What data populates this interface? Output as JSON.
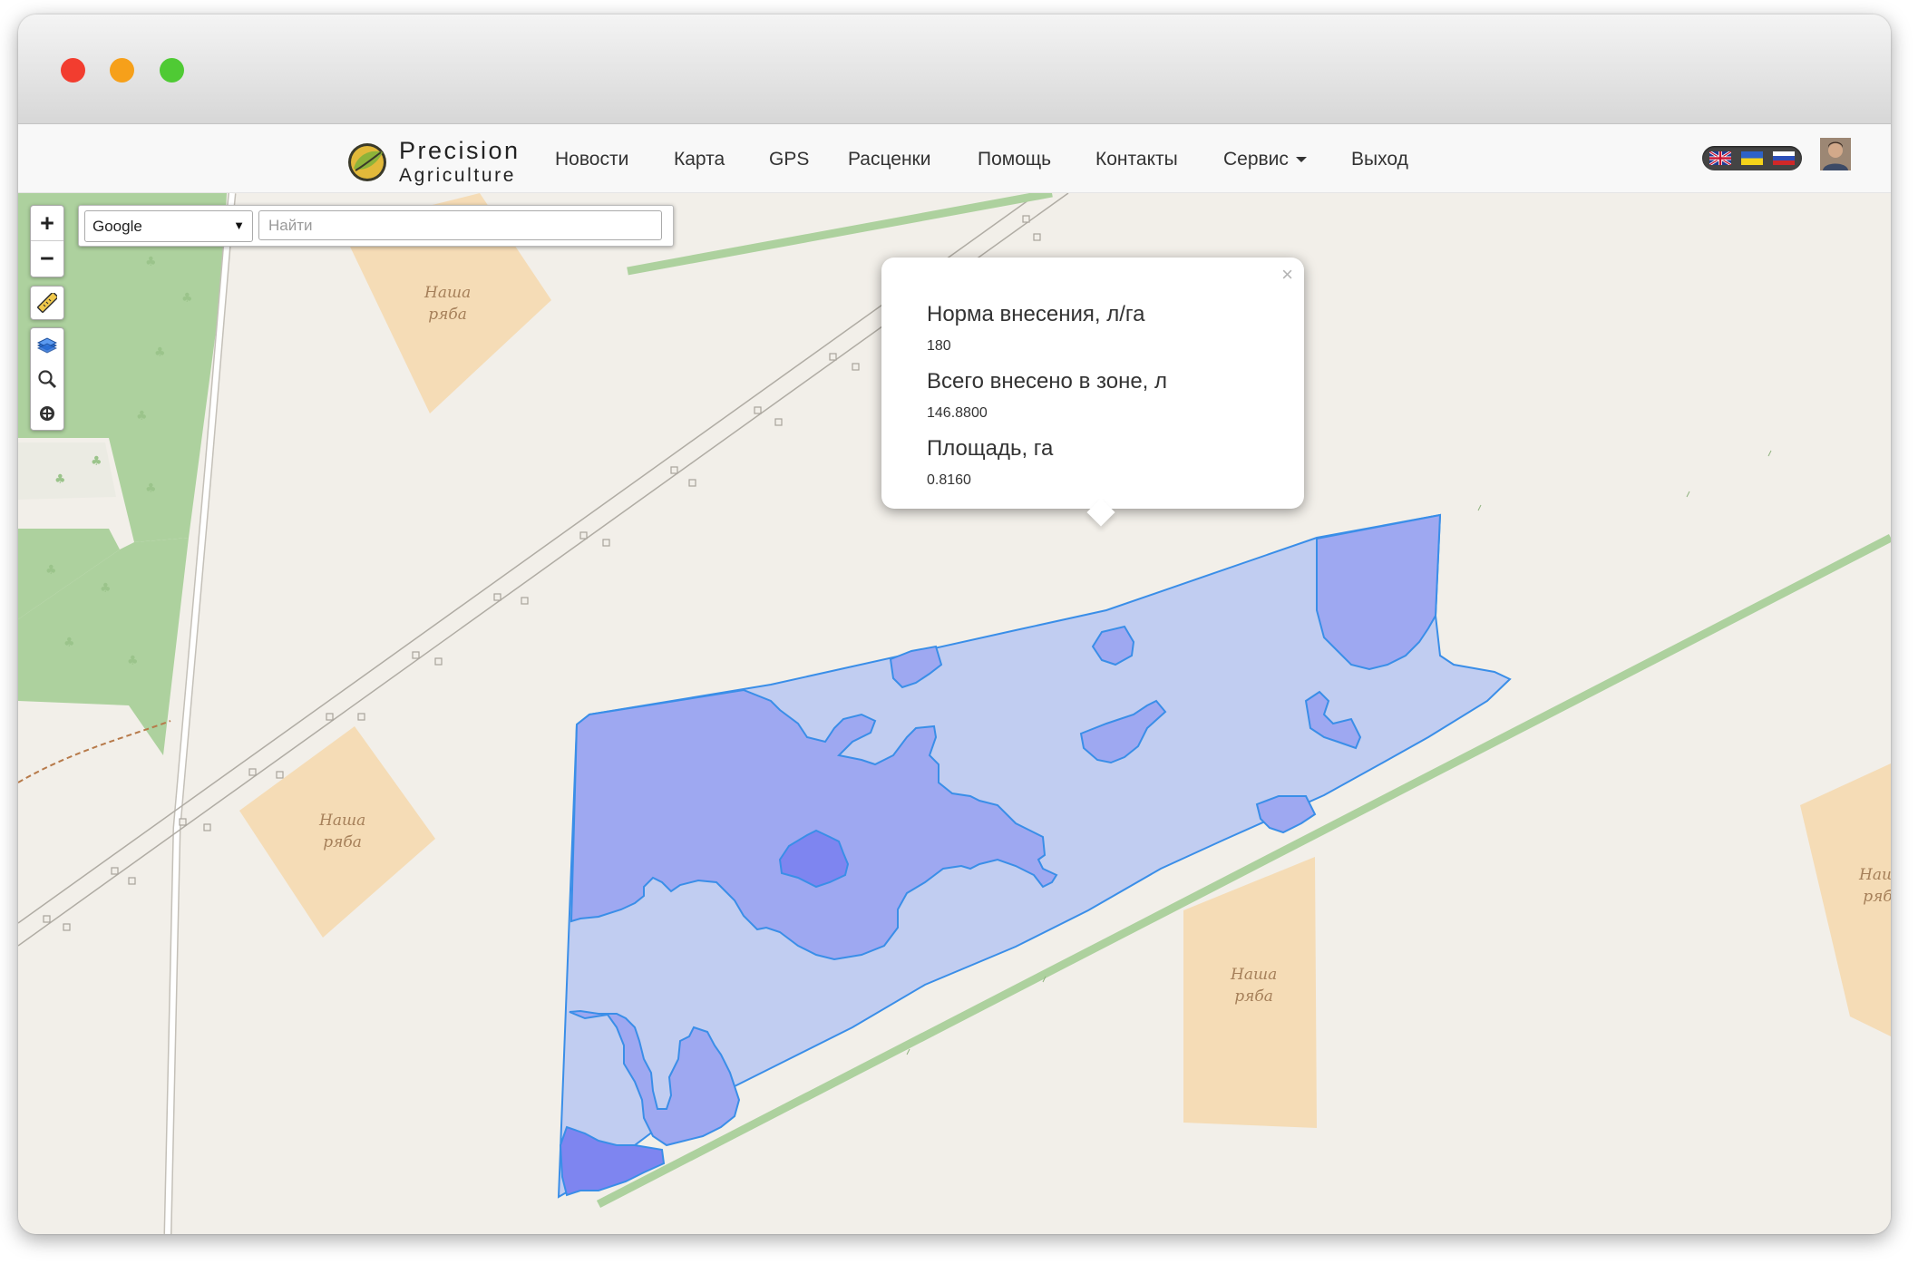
{
  "window": {
    "controls": [
      "close",
      "minimize",
      "maximize"
    ]
  },
  "brand": {
    "line1": "Precision",
    "line2": "Agriculture",
    "icon": "leaf-globe-icon"
  },
  "nav": {
    "items": [
      {
        "label": "Новости"
      },
      {
        "label": "Карта"
      },
      {
        "label": "GPS"
      },
      {
        "label": "Расценки"
      },
      {
        "label": "Помощь"
      },
      {
        "label": "Контакты"
      },
      {
        "label": "Сервис",
        "dropdown": true
      },
      {
        "label": "Выход"
      }
    ],
    "languages": [
      "en",
      "uk",
      "ru"
    ]
  },
  "map_controls": {
    "zoom_in": "+",
    "zoom_out": "−",
    "tools": [
      "ruler-icon",
      "layers-icon",
      "search-icon",
      "locate-icon"
    ]
  },
  "search": {
    "provider": "Google",
    "placeholder": "Найти",
    "value": ""
  },
  "map": {
    "place_labels": [
      {
        "text": "Наша\nряба"
      },
      {
        "text": "Наша\nряба"
      },
      {
        "text": "Наша\nряба"
      },
      {
        "text": "Наш\nряб"
      }
    ],
    "zone_colors": {
      "low": "#c1cdf1",
      "mid": "#9ea8f1",
      "high": "#7e85f0",
      "outline": "#3a8ee8"
    }
  },
  "popup": {
    "rows": [
      {
        "label": "Норма внесения, л/га",
        "value": "180"
      },
      {
        "label": "Всего внесено в зоне, л",
        "value": "146.8800"
      },
      {
        "label": "Площадь, га",
        "value": "0.8160"
      }
    ],
    "close": "×"
  }
}
